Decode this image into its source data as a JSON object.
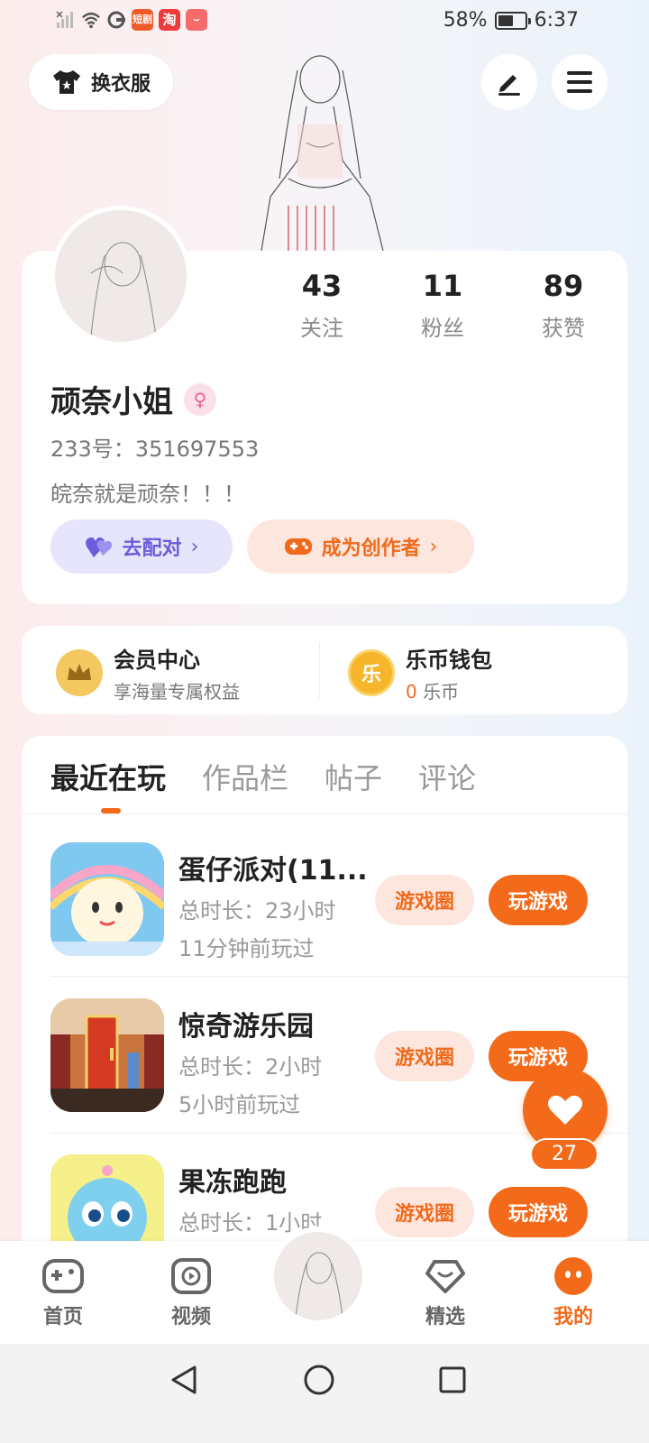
{
  "status_bar": {
    "battery": "58%",
    "time": "6:37",
    "battery_level": 0.58,
    "app_badges": [
      "短剧",
      "淘"
    ]
  },
  "header": {
    "outfit_label": "换衣服",
    "edit_icon": "pen-icon",
    "menu_icon": "menu-icon"
  },
  "profile": {
    "stats": [
      {
        "value": "43",
        "label": "关注"
      },
      {
        "value": "11",
        "label": "粉丝"
      },
      {
        "value": "89",
        "label": "获赞"
      }
    ],
    "nickname": "顽奈小姐",
    "gender_symbol": "♀",
    "uid": "233号：351697553",
    "bio": "皖奈就是顽奈！！！",
    "match_label": "去配对",
    "creator_label": "成为创作者",
    "chevron": "›"
  },
  "vip": {
    "member_title": "会员中心",
    "member_sub": "享海量专属权益",
    "wallet_title": "乐币钱包",
    "wallet_amount": "0",
    "wallet_unit": "乐币",
    "coin_char": "乐"
  },
  "tabs": [
    "最近在玩",
    "作品栏",
    "帖子",
    "评论"
  ],
  "games": [
    {
      "name": "蛋仔派对(11...",
      "duration": "总时长：23小时",
      "last_played": "11分钟前玩过",
      "circle_label": "游戏圈",
      "play_label": "玩游戏"
    },
    {
      "name": "惊奇游乐园",
      "duration": "总时长：2小时",
      "last_played": "5小时前玩过",
      "circle_label": "游戏圈",
      "play_label": "玩游戏"
    },
    {
      "name": "果冻跑跑",
      "duration": "总时长：1小时",
      "last_played": "",
      "circle_label": "游戏圈",
      "play_label": "玩游戏"
    }
  ],
  "like_count": "27",
  "bottom_nav": [
    {
      "label": "首页",
      "icon": "gamepad-icon"
    },
    {
      "label": "视频",
      "icon": "video-icon"
    },
    {
      "label": "精选",
      "icon": "heart-diamond-icon"
    },
    {
      "label": "我的",
      "icon": "profile-face-icon"
    }
  ],
  "colors": {
    "accent": "#f36a1a",
    "purple": "#6b5cd9",
    "pink": "#ec5e91"
  }
}
